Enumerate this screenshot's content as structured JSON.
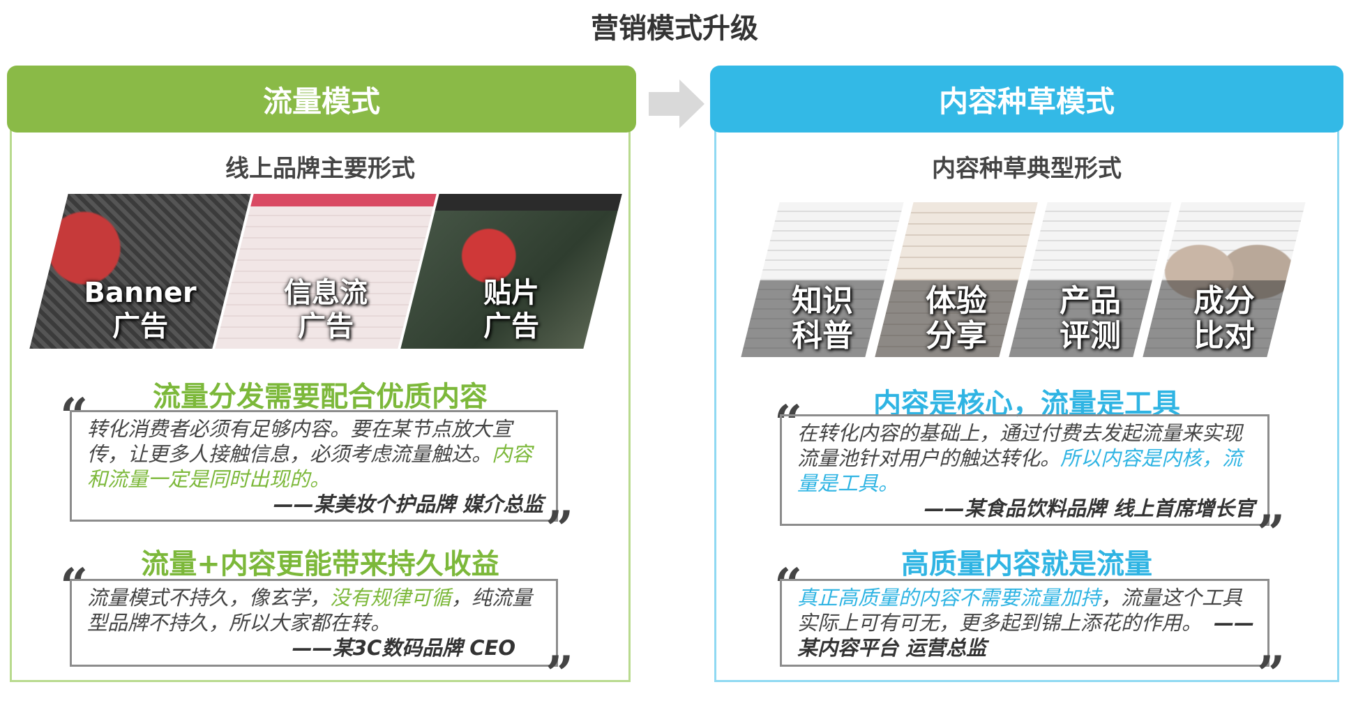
{
  "page_title": "营销模式升级",
  "left": {
    "header": "流量模式",
    "subtitle": "线上品牌主要形式",
    "tiles": [
      {
        "line1": "Banner",
        "line2": "广告"
      },
      {
        "line1": "信息流",
        "line2": "广告"
      },
      {
        "line1": "贴片",
        "line2": "广告"
      }
    ],
    "sections": [
      {
        "heading": "流量分发需要配合优质内容",
        "quote_a": "转化消费者必须有足够内容。要在某节点放大宣传，让更多人接触信息，必须考虑流量触达。",
        "quote_hl": "内容和流量一定是同时出现的。",
        "attribution": "——某美妆个护品牌 媒介总监"
      },
      {
        "heading": "流量+内容更能带来持久收益",
        "quote_a": "流量模式不持久，像玄学，",
        "quote_hl": "没有规律可循",
        "quote_b": "，纯流量型品牌不持久，所以大家都在转。",
        "attribution": "——某3C数码品牌 CEO"
      }
    ]
  },
  "right": {
    "header": "内容种草模式",
    "subtitle": "内容种草典型形式",
    "tiles": [
      {
        "line1": "知识",
        "line2": "科普"
      },
      {
        "line1": "体验",
        "line2": "分享"
      },
      {
        "line1": "产品",
        "line2": "评测"
      },
      {
        "line1": "成分",
        "line2": "比对"
      }
    ],
    "sections": [
      {
        "heading": "内容是核心，流量是工具",
        "quote_a": "在转化内容的基础上，通过付费去发起流量来实现流量池针对用户的触达转化。",
        "quote_hl": "所以内容是内核，流量是工具。",
        "attribution": "——某食品饮料品牌 线上首席增长官"
      },
      {
        "heading": "高质量内容就是流量",
        "quote_hl": "真正高质量的内容不需要流量加持",
        "quote_a": "，流量这个工具实际上可有可无，更多起到锦上添花的作用。",
        "attribution": "——某内容平台 运营总监"
      }
    ]
  },
  "quote_open": "“",
  "quote_close": "”",
  "colors": {
    "green": "#8aba47",
    "blue": "#33b9e6",
    "arrow": "#d9d9d9"
  }
}
